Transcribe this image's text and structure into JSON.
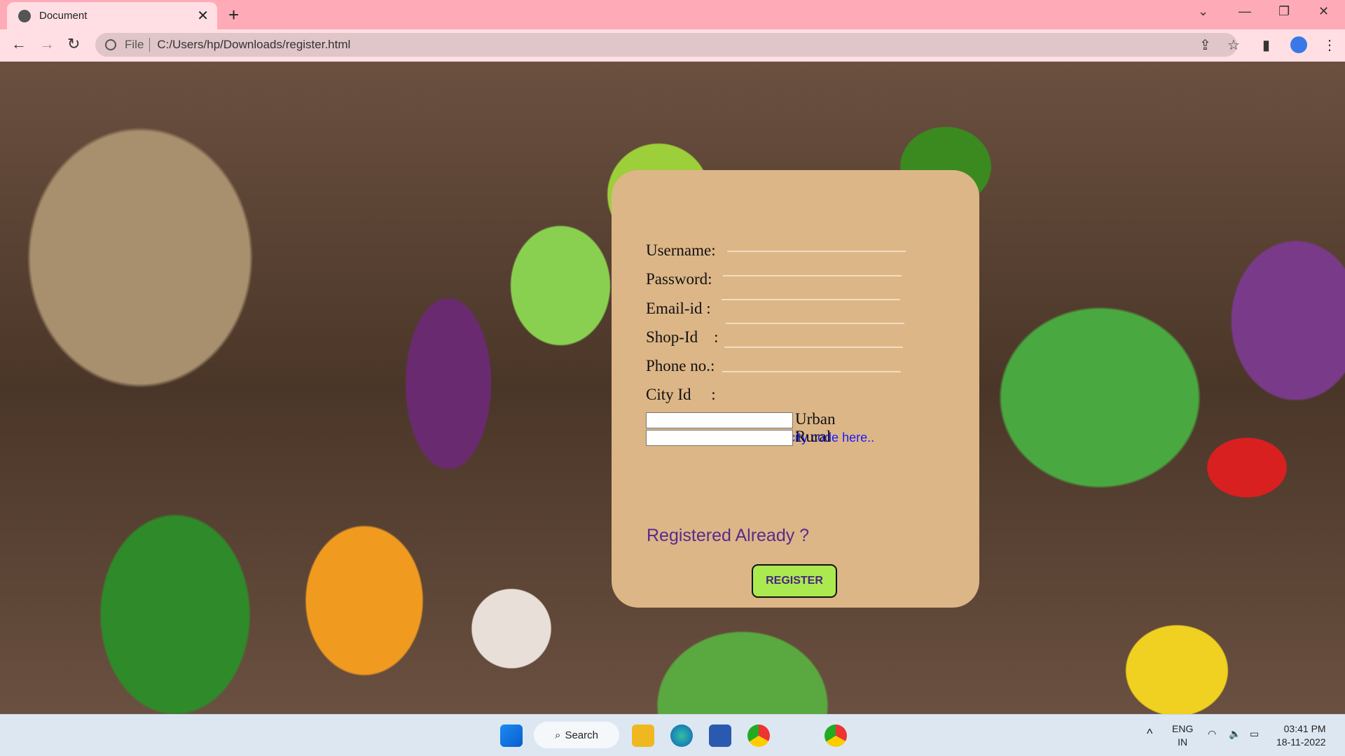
{
  "browser": {
    "tab_title": "Document",
    "address_scheme": "File",
    "url": "C:/Users/hp/Downloads/register.html"
  },
  "form": {
    "fields": [
      {
        "label": "Username:"
      },
      {
        "label": "Password:"
      },
      {
        "label": "Email-id :"
      },
      {
        "label": "Shop-Id    :"
      },
      {
        "label": "Phone no.:"
      },
      {
        "label": "City Id     :"
      }
    ],
    "city_link": "Refer your city code here..",
    "options": [
      {
        "label": "Urban"
      },
      {
        "label": "Rural"
      }
    ],
    "registered_link": "Registered Already ?",
    "register_button": "REGISTER"
  },
  "taskbar": {
    "search_label": "Search",
    "lang_1": "ENG",
    "lang_2": "IN",
    "time": "03:41 PM",
    "date": "18-11-2022"
  },
  "colors": {
    "card": "#dcb687",
    "button": "#aaea50",
    "link": "#1a1aff",
    "registered": "#5a2a8a"
  }
}
